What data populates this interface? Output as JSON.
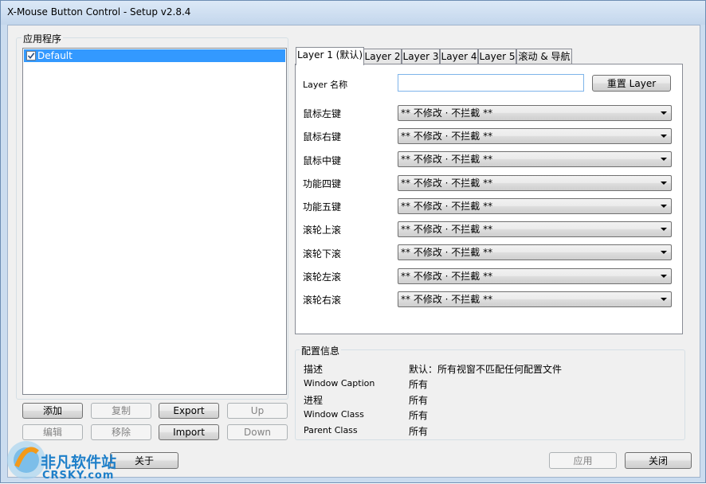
{
  "window": {
    "title": "X-Mouse Button Control - Setup v2.8.4"
  },
  "apps": {
    "group_title": "应用程序",
    "items": [
      {
        "label": "Default",
        "checked": true
      }
    ]
  },
  "buttons": {
    "add": "添加",
    "copy": "复制",
    "export": "Export",
    "up": "Up",
    "edit": "编辑",
    "remove": "移除",
    "import": "Import",
    "down": "Down",
    "about": "关于",
    "apply": "应用",
    "close": "关闭"
  },
  "tabs": [
    {
      "label": "Layer 1 (默认)"
    },
    {
      "label": "Layer 2"
    },
    {
      "label": "Layer 3"
    },
    {
      "label": "Layer 4"
    },
    {
      "label": "Layer 5"
    },
    {
      "label": "滚动 & 导航"
    }
  ],
  "layer": {
    "name_label": "Layer 名称",
    "name_value": "",
    "reset_label": "重置 Layer",
    "rows": [
      {
        "label": "鼠标左键",
        "value": "** 不修改 · 不拦截 **"
      },
      {
        "label": "鼠标右键",
        "value": "** 不修改 · 不拦截 **"
      },
      {
        "label": "鼠标中键",
        "value": "** 不修改 · 不拦截 **"
      },
      {
        "label": "功能四键",
        "value": "** 不修改 · 不拦截 **"
      },
      {
        "label": "功能五键",
        "value": "** 不修改 · 不拦截 **"
      },
      {
        "label": "滚轮上滚",
        "value": "** 不修改 · 不拦截 **"
      },
      {
        "label": "滚轮下滚",
        "value": "** 不修改 · 不拦截 **"
      },
      {
        "label": "滚轮左滚",
        "value": "** 不修改 · 不拦截 **"
      },
      {
        "label": "滚轮右滚",
        "value": "** 不修改 · 不拦截 **"
      }
    ]
  },
  "profile": {
    "group_title": "配置信息",
    "rows": [
      {
        "label": "描述",
        "value": "默认：所有视窗不匹配任何配置文件"
      },
      {
        "label": "Window Caption",
        "value": "所有"
      },
      {
        "label": "进程",
        "value": "所有"
      },
      {
        "label": "Window Class",
        "value": "所有"
      },
      {
        "label": "Parent Class",
        "value": "所有"
      }
    ]
  },
  "watermark": {
    "text": "非凡软件站",
    "sub": "CRSKY.com"
  }
}
